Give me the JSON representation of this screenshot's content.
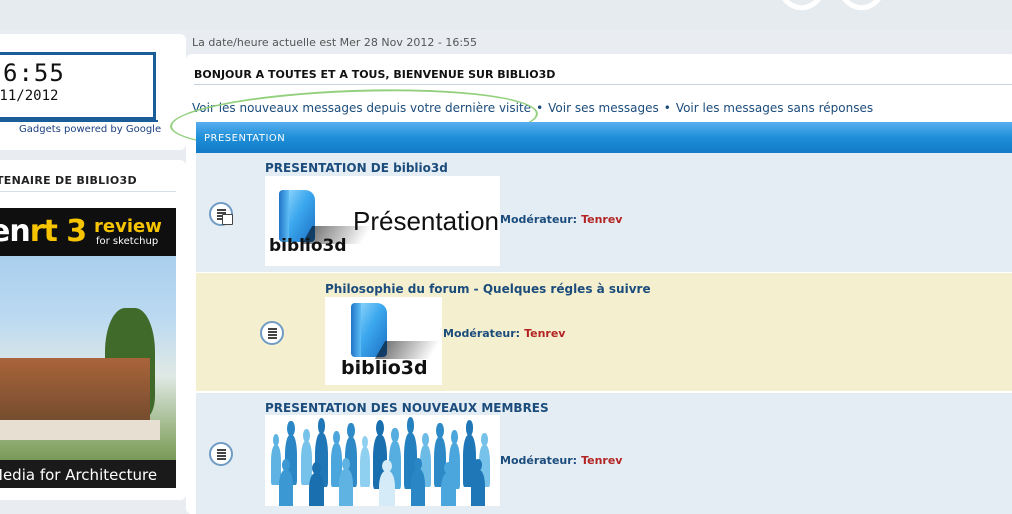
{
  "clock": {
    "time": "6:55",
    "date": "/11/2012",
    "gadgets_note": "Gadgets powered by Google"
  },
  "partner": {
    "title": "TENAIRE DE BIBLIO3D",
    "ad": {
      "brand_prefix": "en",
      "brand_suffix": "rt 3",
      "review": "review",
      "review_sub": "for sketchup",
      "footer": "Media for Architecture"
    }
  },
  "main": {
    "current_date": "La date/heure actuelle est Mer 28 Nov 2012 - 16:55",
    "welcome": "BONJOUR A TOUTES ET A TOUS, BIENVENUE SUR BIBLIO3D",
    "links": [
      "Voir les nouveaux messages depuis votre dernière visite",
      "Voir ses messages",
      "Voir les messages sans réponses"
    ],
    "separator": "•"
  },
  "category": {
    "title": "PRESENTATION"
  },
  "forums": [
    {
      "title": "PRESENTATION DE biblio3d",
      "banner_text": "Présentation",
      "logo_text": "biblio3d",
      "moderator_label": "Modérateur:",
      "moderator": "Tenrev"
    },
    {
      "title": "Philosophie du forum - Quelques régles à suivre",
      "logo_text": "biblio3d",
      "moderator_label": "Modérateur:",
      "moderator": "Tenrev"
    },
    {
      "title": "PRESENTATION DES NOUVEAUX MEMBRES",
      "moderator_label": "Modérateur:",
      "moderator": "Tenrev"
    }
  ],
  "colors": {
    "link": "#1b4c7c",
    "moderator_name": "#b32424",
    "category_header": "#1e8fd8",
    "highlight_row": "#f4f0cf"
  }
}
